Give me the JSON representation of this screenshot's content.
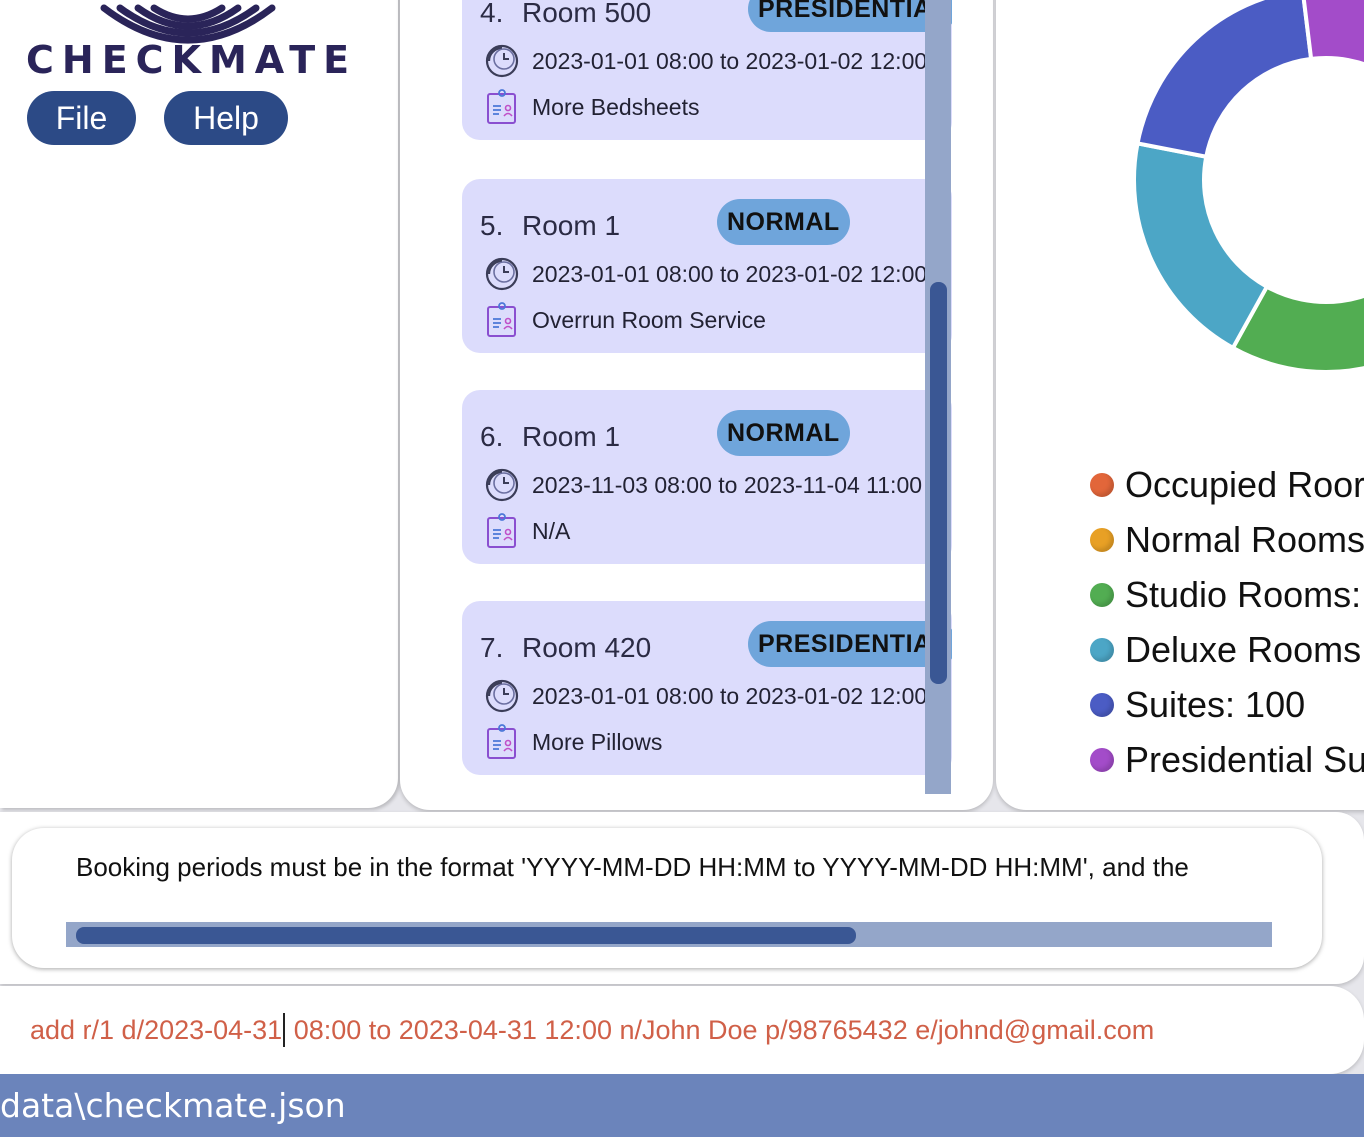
{
  "app": {
    "logo_text": "CHECKMATE",
    "menu": {
      "file_label": "File",
      "help_label": "Help"
    }
  },
  "bookings": [
    {
      "index": "4.",
      "room": "Room 500",
      "type": "PRESIDENTIAL",
      "period": "2023-01-01 08:00 to 2023-01-02 12:00",
      "request": "More Bedsheets",
      "badge_color": "#6fa5db"
    },
    {
      "index": "5.",
      "room": "Room 1",
      "type": "NORMAL",
      "period": "2023-01-01 08:00 to 2023-01-02 12:00",
      "request": "Overrun Room Service",
      "badge_color": "#6fa5db"
    },
    {
      "index": "6.",
      "room": "Room 1",
      "type": "NORMAL",
      "period": "2023-11-03 08:00 to 2023-11-04 11:00",
      "request": "N/A",
      "badge_color": "#6fa5db"
    },
    {
      "index": "7.",
      "room": "Room 420",
      "type": "PRESIDENTIAL",
      "period": "2023-01-01 08:00 to 2023-01-02 12:00",
      "request": "More Pillows",
      "badge_color": "#6fa5db"
    }
  ],
  "chart_data": {
    "type": "pie",
    "categories": [
      "Occupied Rooms",
      "Normal Rooms",
      "Studio Rooms",
      "Deluxe Rooms",
      "Suites",
      "Presidential Suites"
    ],
    "colors": [
      "#e2663a",
      "#e8a025",
      "#52ad52",
      "#4ca6c6",
      "#4b5cc4",
      "#a34cc9"
    ],
    "values": [
      0,
      100,
      100,
      100,
      100,
      100
    ]
  },
  "legend": [
    {
      "text": "Occupied Roor",
      "color": "#e2663a"
    },
    {
      "text": "Normal Rooms",
      "color": "#e8a025"
    },
    {
      "text": "Studio Rooms:",
      "color": "#52ad52"
    },
    {
      "text": "Deluxe Rooms",
      "color": "#4ca6c6"
    },
    {
      "text": "Suites: 100",
      "color": "#4b5cc4"
    },
    {
      "text": "Presidential Su",
      "color": "#a34cc9"
    }
  ],
  "result": {
    "message": "Booking periods must be in the format 'YYYY-MM-DD HH:MM to YYYY-MM-DD HH:MM', and the"
  },
  "command": {
    "before_caret": "add r/1 d/2023-04-31",
    "after_caret": " 08:00 to 2023-04-31 12:00 n/John Doe p/98765432 e/johnd@gmail.com"
  },
  "status": {
    "file_path": "data\\checkmate.json"
  }
}
